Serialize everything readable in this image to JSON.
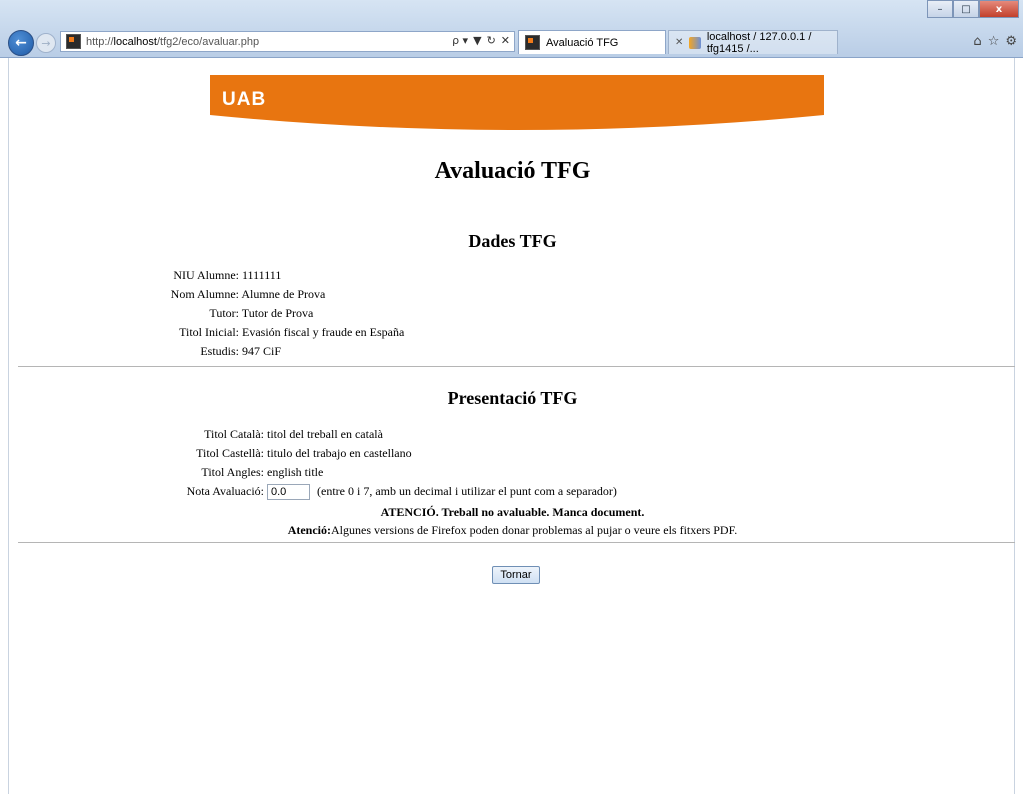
{
  "browser": {
    "url_prefix": "http://",
    "url_host": "localhost",
    "url_path": "/tfg2/eco/avaluar.php",
    "tabs": [
      {
        "title": "Avaluació TFG"
      },
      {
        "title": "localhost / 127.0.0.1 / tfg1415 /..."
      }
    ],
    "addr_tools": [
      "ρ ▾",
      "▼",
      "↻",
      "✕"
    ],
    "win_controls": {
      "min": "–",
      "max": "□",
      "close": "x"
    },
    "right_icons": [
      "⌂",
      "☆",
      "⚙"
    ]
  },
  "banner": {
    "logo": "UAB",
    "color": "#e87510"
  },
  "page_title": "Avaluació TFG",
  "dades": {
    "heading": "Dades TFG",
    "rows": [
      {
        "label": "NIU Alumne:",
        "value": "1111111"
      },
      {
        "label": "Nom Alumne:",
        "value": "Alumne de Prova"
      },
      {
        "label": "Tutor:",
        "value": "Tutor de Prova"
      },
      {
        "label": "Titol Inicial:",
        "value": "Evasión fiscal y fraude en España"
      },
      {
        "label": "Estudis:",
        "value": "947 CiF"
      }
    ]
  },
  "presentacio": {
    "heading": "Presentació TFG",
    "rows": [
      {
        "label": "Titol Català:",
        "value": "titol del treball en català"
      },
      {
        "label": "Titol Castellà:",
        "value": "titulo del trabajo en castellano"
      },
      {
        "label": "Titol Angles:",
        "value": "english title"
      }
    ],
    "nota": {
      "label": "Nota Avaluació:",
      "value": "0.0",
      "hint": "(entre 0 i 7, amb un decimal i utilizar el punt com a separador)"
    },
    "warning": "ATENCIÓ. Treball no avaluable. Manca document.",
    "notice_bold": "Atenció:",
    "notice_text": "Algunes versions de Firefox poden donar problemas al pujar o veure els fitxers PDF."
  },
  "tornar_label": "Tornar"
}
